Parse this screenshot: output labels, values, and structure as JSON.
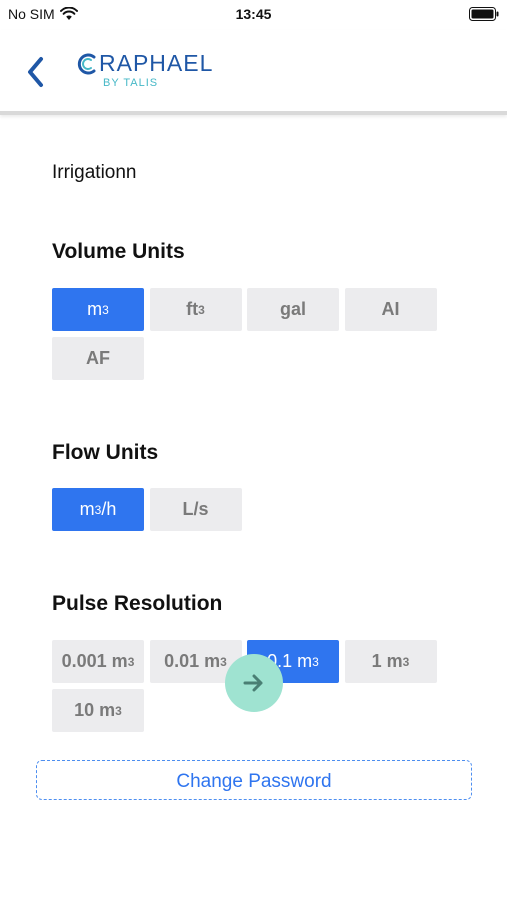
{
  "status_bar": {
    "carrier": "No SIM",
    "time": "13:45"
  },
  "header": {
    "logo_text": "RAPHAEL",
    "logo_sub": "BY TALIS"
  },
  "app_name": "Irrigationn",
  "volume_units": {
    "title": "Volume Units",
    "options": [
      {
        "base": "m",
        "sup": "3",
        "tail": "",
        "selected": true
      },
      {
        "base": "ft",
        "sup": "3",
        "tail": "",
        "selected": false
      },
      {
        "base": "gal",
        "sup": "",
        "tail": "",
        "selected": false
      },
      {
        "base": "AI",
        "sup": "",
        "tail": "",
        "selected": false
      },
      {
        "base": "AF",
        "sup": "",
        "tail": "",
        "selected": false
      }
    ]
  },
  "flow_units": {
    "title": "Flow Units",
    "options": [
      {
        "base": "m",
        "sup": "3",
        "tail": "/h",
        "selected": true
      },
      {
        "base": "L/s",
        "sup": "",
        "tail": "",
        "selected": false
      }
    ]
  },
  "pulse_resolution": {
    "title": "Pulse Resolution",
    "options": [
      {
        "base": "0.001 m",
        "sup": "3",
        "tail": "",
        "selected": false
      },
      {
        "base": "0.01 m",
        "sup": "3",
        "tail": "",
        "selected": false
      },
      {
        "base": "0.1 m",
        "sup": "3",
        "tail": "",
        "selected": true
      },
      {
        "base": "1 m",
        "sup": "3",
        "tail": "",
        "selected": false
      },
      {
        "base": "10 m",
        "sup": "3",
        "tail": "",
        "selected": false
      }
    ]
  },
  "change_password_label": "Change Password",
  "colors": {
    "accent": "#2f75ef",
    "next_button": "#9fe3d1",
    "logo": "#1f57a6",
    "logo_sub": "#46b8c7"
  }
}
